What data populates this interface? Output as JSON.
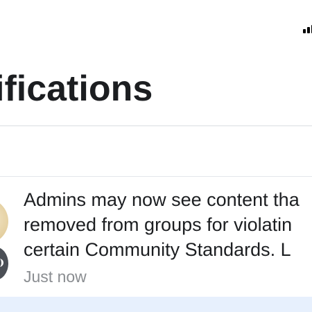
{
  "header": {
    "title": "ifications"
  },
  "notification": {
    "lines": [
      "Admins may now see content tha",
      "removed from groups for violatin",
      "certain Community Standards. L"
    ],
    "time": "Just now"
  },
  "colors": {
    "unread_background": "#e7f0fd",
    "secondary_text": "#8a8d91",
    "primary_text": "#1c1e21"
  },
  "icons": {
    "status": "cellular-signal-icon",
    "badge": "groups-badge-icon"
  }
}
